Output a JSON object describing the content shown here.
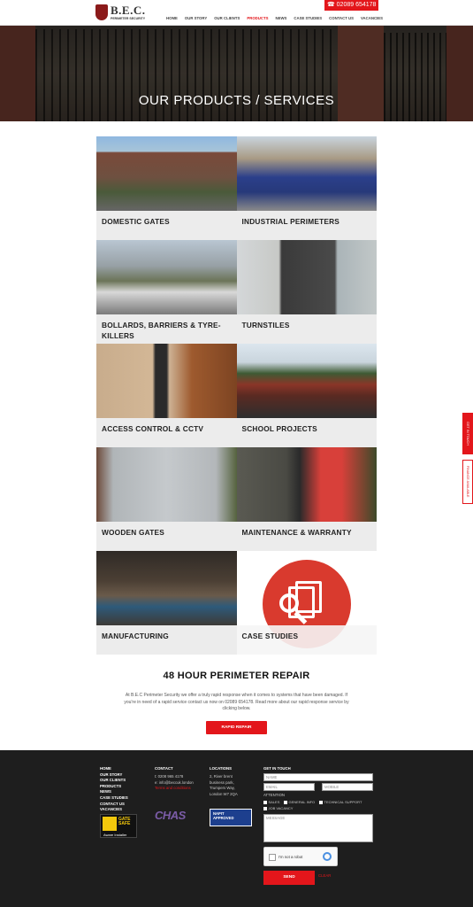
{
  "header": {
    "logo_name": "B.E.C.",
    "logo_tagline": "PERIMETER SECURITY",
    "phone": "☎ 02089 654178",
    "nav": [
      "HOME",
      "OUR STORY",
      "OUR CLIENTS",
      "PRODUCTS",
      "NEWS",
      "CASE STUDIES",
      "CONTACT US",
      "VACANCIES"
    ],
    "active_nav": "PRODUCTS"
  },
  "hero": {
    "title": "OUR PRODUCTS / SERVICES"
  },
  "tiles": [
    {
      "label": "DOMESTIC GATES",
      "photo": "brick-pillar-gate-photo"
    },
    {
      "label": "INDUSTRIAL PERIMETERS",
      "photo": "blue-fence-photo"
    },
    {
      "label": "BOLLARDS, BARRIERS & TYRE-KILLERS",
      "photo": "barrier-photo"
    },
    {
      "label": "TURNSTILES",
      "photo": "turnstile-photo"
    },
    {
      "label": "ACCESS CONTROL & CCTV",
      "photo": "keypad-photo"
    },
    {
      "label": "SCHOOL PROJECTS",
      "photo": "school-gate-photo"
    },
    {
      "label": "WOODEN GATES",
      "photo": "wooden-gate-photo"
    },
    {
      "label": "MAINTENANCE & WARRANTY",
      "photo": "engineer-photo"
    },
    {
      "label": "MANUFACTURING",
      "photo": "workshop-photo"
    },
    {
      "label": "CASE STUDIES",
      "photo": "case-studies-icon"
    }
  ],
  "repair": {
    "title": "48 HOUR PERIMETER REPAIR",
    "text": "At B.E.C Perimeter Security we offer a truly rapid response when it comes to systems that have been damaged. If you're in need of a rapid service contact us now on 02089 654178. Read more about our rapid response service by clicking below.",
    "button": "RAPID REPAIR"
  },
  "side_tabs": {
    "get_in_touch": "GET IN TOUCH",
    "finance": "FINANCE AVAILABLE"
  },
  "footer": {
    "links": [
      "HOME",
      "OUR STORY",
      "OUR CLIENTS",
      "PRODUCTS",
      "NEWS",
      "CASE STUDIES",
      "CONTACT US",
      "VACANCIES"
    ],
    "contact_head": "CONTACT",
    "tel": "t: 0208 965 4178",
    "email": "e: info@beccuk.london",
    "terms": "Terms and conditions",
    "locations_head": "LOCATIONS",
    "address": [
      "2, River brent",
      "business park,",
      "Trumpers Way,",
      "London W7 2QA"
    ],
    "git_head": "GET IN TOUCH",
    "name_placeholder": "NAME",
    "email_placeholder": "EMAIL",
    "mobile_placeholder": "MOBILE",
    "attention": "ATTENTION",
    "checks": [
      "SALES",
      "GENERAL INFO",
      "TECHNICAL SUPPORT",
      "JOB VACANCY"
    ],
    "message_placeholder": "MESSAGE",
    "captcha": "I'm not a robot",
    "send": "SEND",
    "clear": "CLEAR",
    "badges": {
      "gate_safe_1": "GATE",
      "gate_safe_2": "SAFE",
      "gate_safe_3": "Aware Installer",
      "chas": "CHAS",
      "napit_1": "NAPIT",
      "napit_2": "APPROVED"
    }
  }
}
